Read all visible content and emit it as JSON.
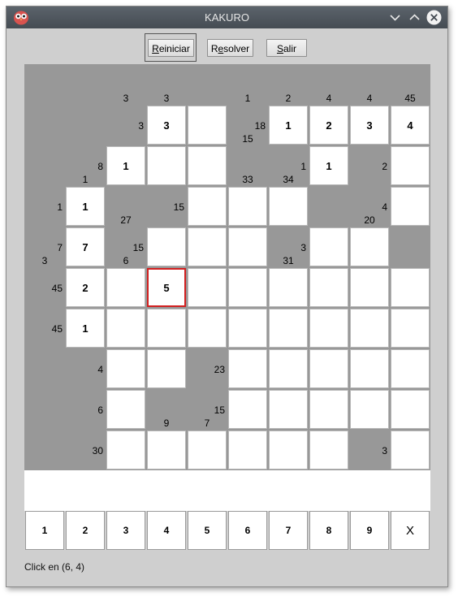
{
  "window": {
    "title": "KAKURO"
  },
  "toolbar": {
    "reiniciar": {
      "mnemonic": "R",
      "rest": "einiciar"
    },
    "resolver": {
      "pre": "R",
      "mnemonic": "e",
      "rest": "solver"
    },
    "salir": {
      "mnemonic": "S",
      "rest": "alir"
    }
  },
  "board": {
    "rows": [
      [
        {
          "t": "b"
        },
        {
          "t": "b"
        },
        {
          "t": "c",
          "d": "3"
        },
        {
          "t": "c",
          "d": "3"
        },
        {
          "t": "b"
        },
        {
          "t": "c",
          "d": "1"
        },
        {
          "t": "c",
          "d": "2"
        },
        {
          "t": "c",
          "d": "4"
        },
        {
          "t": "c",
          "d": "4"
        },
        {
          "t": "c",
          "d": "45"
        }
      ],
      [
        {
          "t": "b"
        },
        {
          "t": "b"
        },
        {
          "t": "c",
          "r": "3"
        },
        {
          "t": "w",
          "v": "3"
        },
        {
          "t": "w",
          "v": ""
        },
        {
          "t": "c",
          "d": "15",
          "r": "18"
        },
        {
          "t": "w",
          "v": "1"
        },
        {
          "t": "w",
          "v": "2"
        },
        {
          "t": "w",
          "v": "3"
        },
        {
          "t": "w",
          "v": "4"
        },
        {
          "t": "w",
          "v": ""
        }
      ],
      [
        {
          "t": "b"
        },
        {
          "t": "c",
          "d": "1",
          "r": "8"
        },
        {
          "t": "w",
          "v": "1"
        },
        {
          "t": "w",
          "v": ""
        },
        {
          "t": "w",
          "v": ""
        },
        {
          "t": "c",
          "d": "33"
        },
        {
          "t": "c",
          "d": "34",
          "r": "1"
        },
        {
          "t": "w",
          "v": "1"
        },
        {
          "t": "c",
          "r": "2"
        },
        {
          "t": "w",
          "v": ""
        }
      ],
      [
        {
          "t": "c",
          "r": "1"
        },
        {
          "t": "w",
          "v": "1"
        },
        {
          "t": "c",
          "d": "27"
        },
        {
          "t": "c",
          "r": "15"
        },
        {
          "t": "w",
          "v": ""
        },
        {
          "t": "w",
          "v": ""
        },
        {
          "t": "w",
          "v": ""
        },
        {
          "t": "b"
        },
        {
          "t": "c",
          "d": "20",
          "r": "4"
        },
        {
          "t": "w",
          "v": ""
        }
      ],
      [
        {
          "t": "c",
          "d": "3",
          "r": "7"
        },
        {
          "t": "w",
          "v": "7"
        },
        {
          "t": "c",
          "d": "6",
          "r": "15"
        },
        {
          "t": "w",
          "v": ""
        },
        {
          "t": "w",
          "v": ""
        },
        {
          "t": "w",
          "v": ""
        },
        {
          "t": "c",
          "d": "31",
          "r": "3"
        },
        {
          "t": "w",
          "v": ""
        },
        {
          "t": "w",
          "v": ""
        }
      ],
      [
        {
          "t": "c",
          "r": "45"
        },
        {
          "t": "w",
          "v": "2"
        },
        {
          "t": "w",
          "v": ""
        },
        {
          "t": "w",
          "v": "5",
          "sel": true
        },
        {
          "t": "w",
          "v": ""
        },
        {
          "t": "w",
          "v": ""
        },
        {
          "t": "w",
          "v": ""
        },
        {
          "t": "w",
          "v": ""
        },
        {
          "t": "w",
          "v": ""
        },
        {
          "t": "w",
          "v": ""
        }
      ],
      [
        {
          "t": "c",
          "r": "45"
        },
        {
          "t": "w",
          "v": "1"
        },
        {
          "t": "w",
          "v": ""
        },
        {
          "t": "w",
          "v": ""
        },
        {
          "t": "w",
          "v": ""
        },
        {
          "t": "w",
          "v": ""
        },
        {
          "t": "w",
          "v": ""
        },
        {
          "t": "w",
          "v": ""
        },
        {
          "t": "w",
          "v": ""
        },
        {
          "t": "w",
          "v": ""
        }
      ],
      [
        {
          "t": "b"
        },
        {
          "t": "c",
          "r": "4"
        },
        {
          "t": "w",
          "v": ""
        },
        {
          "t": "w",
          "v": ""
        },
        {
          "t": "c",
          "r": "23"
        },
        {
          "t": "w",
          "v": ""
        },
        {
          "t": "w",
          "v": ""
        },
        {
          "t": "w",
          "v": ""
        },
        {
          "t": "w",
          "v": ""
        },
        {
          "t": "w",
          "v": ""
        }
      ],
      [
        {
          "t": "b"
        },
        {
          "t": "c",
          "r": "6"
        },
        {
          "t": "w",
          "v": ""
        },
        {
          "t": "c",
          "d": "9"
        },
        {
          "t": "c",
          "d": "7",
          "r": "15"
        },
        {
          "t": "w",
          "v": ""
        },
        {
          "t": "w",
          "v": ""
        },
        {
          "t": "w",
          "v": ""
        },
        {
          "t": "w",
          "v": ""
        },
        {
          "t": "w",
          "v": ""
        }
      ],
      [
        {
          "t": "b"
        },
        {
          "t": "c",
          "r": "30"
        },
        {
          "t": "w",
          "v": ""
        },
        {
          "t": "w",
          "v": ""
        },
        {
          "t": "w",
          "v": ""
        },
        {
          "t": "w",
          "v": ""
        },
        {
          "t": "w",
          "v": ""
        },
        {
          "t": "w",
          "v": ""
        },
        {
          "t": "c",
          "r": "3"
        },
        {
          "t": "w",
          "v": ""
        }
      ]
    ]
  },
  "number_pad": [
    "1",
    "2",
    "3",
    "4",
    "5",
    "6",
    "7",
    "8",
    "9",
    "X"
  ],
  "status": "Click en (6, 4)",
  "colors": {
    "board_black": "#989898",
    "selected_border": "#d22020",
    "titlebar": "#4f565d"
  }
}
